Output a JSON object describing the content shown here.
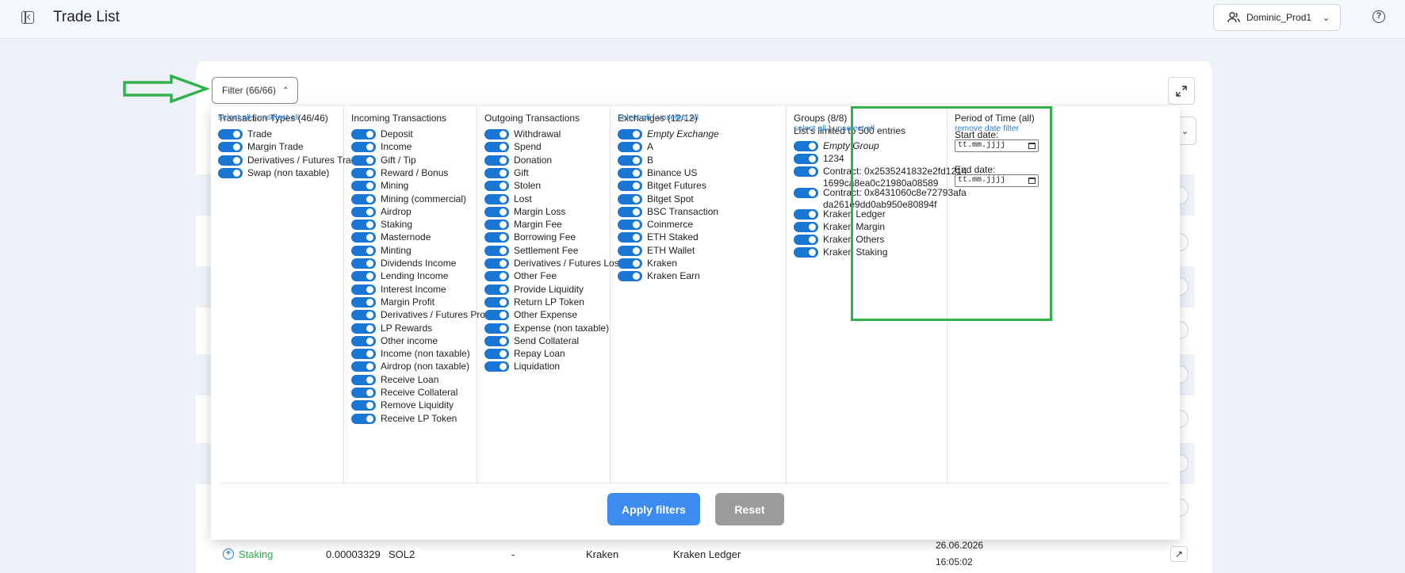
{
  "header": {
    "title": "Trade List",
    "user": "Dominic_Prod1"
  },
  "filter": {
    "button_label": "Filter (66/66)"
  },
  "select_all": "select all",
  "separator": "|",
  "unselect_all": "unselect all",
  "columns": [
    {
      "title": "Transaction Types (46/46)",
      "has_select": true,
      "items": [
        "Trade",
        "Margin Trade",
        "Derivatives / Futures Trade",
        "Swap (non taxable)"
      ]
    },
    {
      "title": "Incoming Transactions",
      "has_select": false,
      "items": [
        "Deposit",
        "Income",
        "Gift / Tip",
        "Reward / Bonus",
        "Mining",
        "Mining (commercial)",
        "Airdrop",
        "Staking",
        "Masternode",
        "Minting",
        "Dividends Income",
        "Lending Income",
        "Interest Income",
        "Margin Profit",
        "Derivatives / Futures Profit",
        "LP Rewards",
        "Other income",
        "Income (non taxable)",
        "Airdrop (non taxable)",
        "Receive Loan",
        "Receive Collateral",
        "Remove Liquidity",
        "Receive LP Token"
      ]
    },
    {
      "title": "Outgoing Transactions",
      "has_select": false,
      "items": [
        "Withdrawal",
        "Spend",
        "Donation",
        "Gift",
        "Stolen",
        "Lost",
        "Margin Loss",
        "Margin Fee",
        "Borrowing Fee",
        "Settlement Fee",
        "Derivatives / Futures Loss",
        "Other Fee",
        "Provide Liquidity",
        "Return LP Token",
        "Other Expense",
        "Expense (non taxable)",
        "Send Collateral",
        "Repay Loan",
        "Liquidation"
      ]
    },
    {
      "title": "Exchanges (12/12)",
      "has_select": true,
      "items": [
        "Empty Exchange",
        "A",
        "B",
        "Binance US",
        "Bitget Futures",
        "Bitget Spot",
        "BSC Transaction",
        "Coinmerce",
        "ETH Staked",
        "ETH Wallet",
        "Kraken",
        "Kraken Earn"
      ]
    }
  ],
  "groups": {
    "title": "Groups (8/8)",
    "note": "List's limited to 500 entries",
    "items": [
      "Empty Group",
      "1234",
      "Contract: 0x2535241832e2fd1214\n1699ca8ea0c21980a08589",
      "Contract: 0x8431060c8e72793afa\nda261e9dd0ab950e80894f",
      "Kraken Ledger",
      "Kraken Margin",
      "Kraken Others",
      "Kraken Staking"
    ]
  },
  "period": {
    "title": "Period of Time (all)",
    "remove_link": "remove date filter",
    "start_label": "Start date:",
    "end_label": "End date:",
    "placeholder": "tt.mm.jjjj"
  },
  "actions": {
    "apply": "Apply filters",
    "reset": "Reset"
  },
  "last_row": {
    "type": "Staking",
    "amount": "0.00003329",
    "currency": "SOL2",
    "dash": "-",
    "exchange": "Kraken",
    "group": "Kraken Ledger",
    "date": "26.06.2026",
    "time": "16:05:02"
  },
  "colors": {
    "toggle": "#1976d2",
    "link": "#2a7ed3",
    "highlight": "#2fb34a",
    "staking": "#2fa84f",
    "apply": "#3b8cee",
    "reset": "#9b9b9b"
  }
}
